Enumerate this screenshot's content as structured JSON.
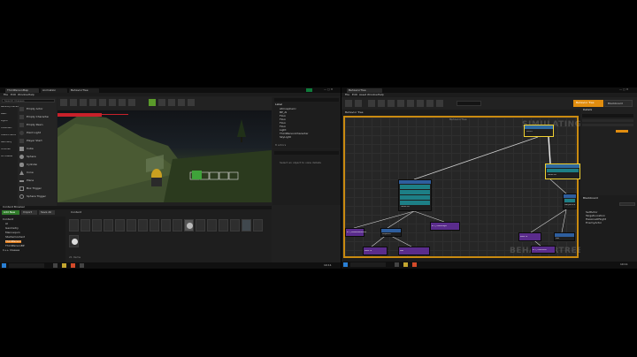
{
  "left_monitor": {
    "title_tabs": [
      "ThirdPersonMap",
      "Animation",
      "BehaviorTree"
    ],
    "menu": [
      "File",
      "Edit",
      "Window",
      "Help"
    ],
    "modes": {
      "search_placeholder": "Search Classes",
      "categories": [
        "Recently Placed",
        "Basic",
        "Lights",
        "Cinematic",
        "Visual Effects",
        "Geometry",
        "Volumes",
        "All Classes"
      ],
      "items": [
        "Empty Actor",
        "Empty Character",
        "Empty Pawn",
        "Point Light",
        "Player Start",
        "Cube",
        "Sphere",
        "Cylinder",
        "Cone",
        "Plane",
        "Box Trigger",
        "Sphere Trigger"
      ]
    },
    "outliner": {
      "header": "Label",
      "items": [
        "Atmospheric",
        "BP_AI",
        "Floor",
        "Floor",
        "Floor",
        "Floor",
        "Light",
        "ThirdPersonCharacter",
        "SkyLight"
      ],
      "footer": "8 actors"
    },
    "details": {
      "hint": "Select an object to view details"
    },
    "content_browser": {
      "tab": "Content Browser",
      "add_button": "Add New",
      "import_button": "Import",
      "save_button": "Save All",
      "path": "Content",
      "folders": [
        "Content",
        "AI",
        "Geometry",
        "Mannequin",
        "StarterContent",
        "ThirdPerson",
        "ThirdPersonBP",
        "C++ Classes"
      ],
      "status": "21 items"
    },
    "taskbar_time": "10:11"
  },
  "right_monitor": {
    "title": "BehaviorTree",
    "menu": [
      "File",
      "Edit",
      "Asset",
      "Window",
      "Help"
    ],
    "graph_header": "BehaviorTree",
    "breadcrumb": "Behavior Tree",
    "watermark_top": "SIMULATING",
    "watermark_bottom": "BEHAVIORTREE",
    "mode_button": "Behavior Tree",
    "blackboard_button": "Blackboard",
    "nodes": {
      "root": "ROOT",
      "selector_top": "Selector",
      "selector_mid": "Selector",
      "sequence_left": "Sequence",
      "sequence_right": "Sequence",
      "task1": "BTT_FindRandomPoint",
      "task2": "Move To",
      "task3": "Wait",
      "task4": "BTT_ChasePlayer",
      "task5": "Move To",
      "task6": "Wait",
      "task7": "BTT_ClearFocus",
      "task8": "Move To"
    },
    "details_title": "Details",
    "blackboard_title": "Blackboard",
    "blackboard_keys": [
      "SelfActor",
      "TargetLocation",
      "HasLineOfSight",
      "EnemyActor"
    ],
    "taskbar_time": "10:11"
  },
  "colors": {
    "graph_border": "#c98a10",
    "node_teal": "#1d7f86",
    "node_purple": "#5a2c8c",
    "node_blue": "#2e5e9e",
    "orange": "#e18d0f"
  }
}
